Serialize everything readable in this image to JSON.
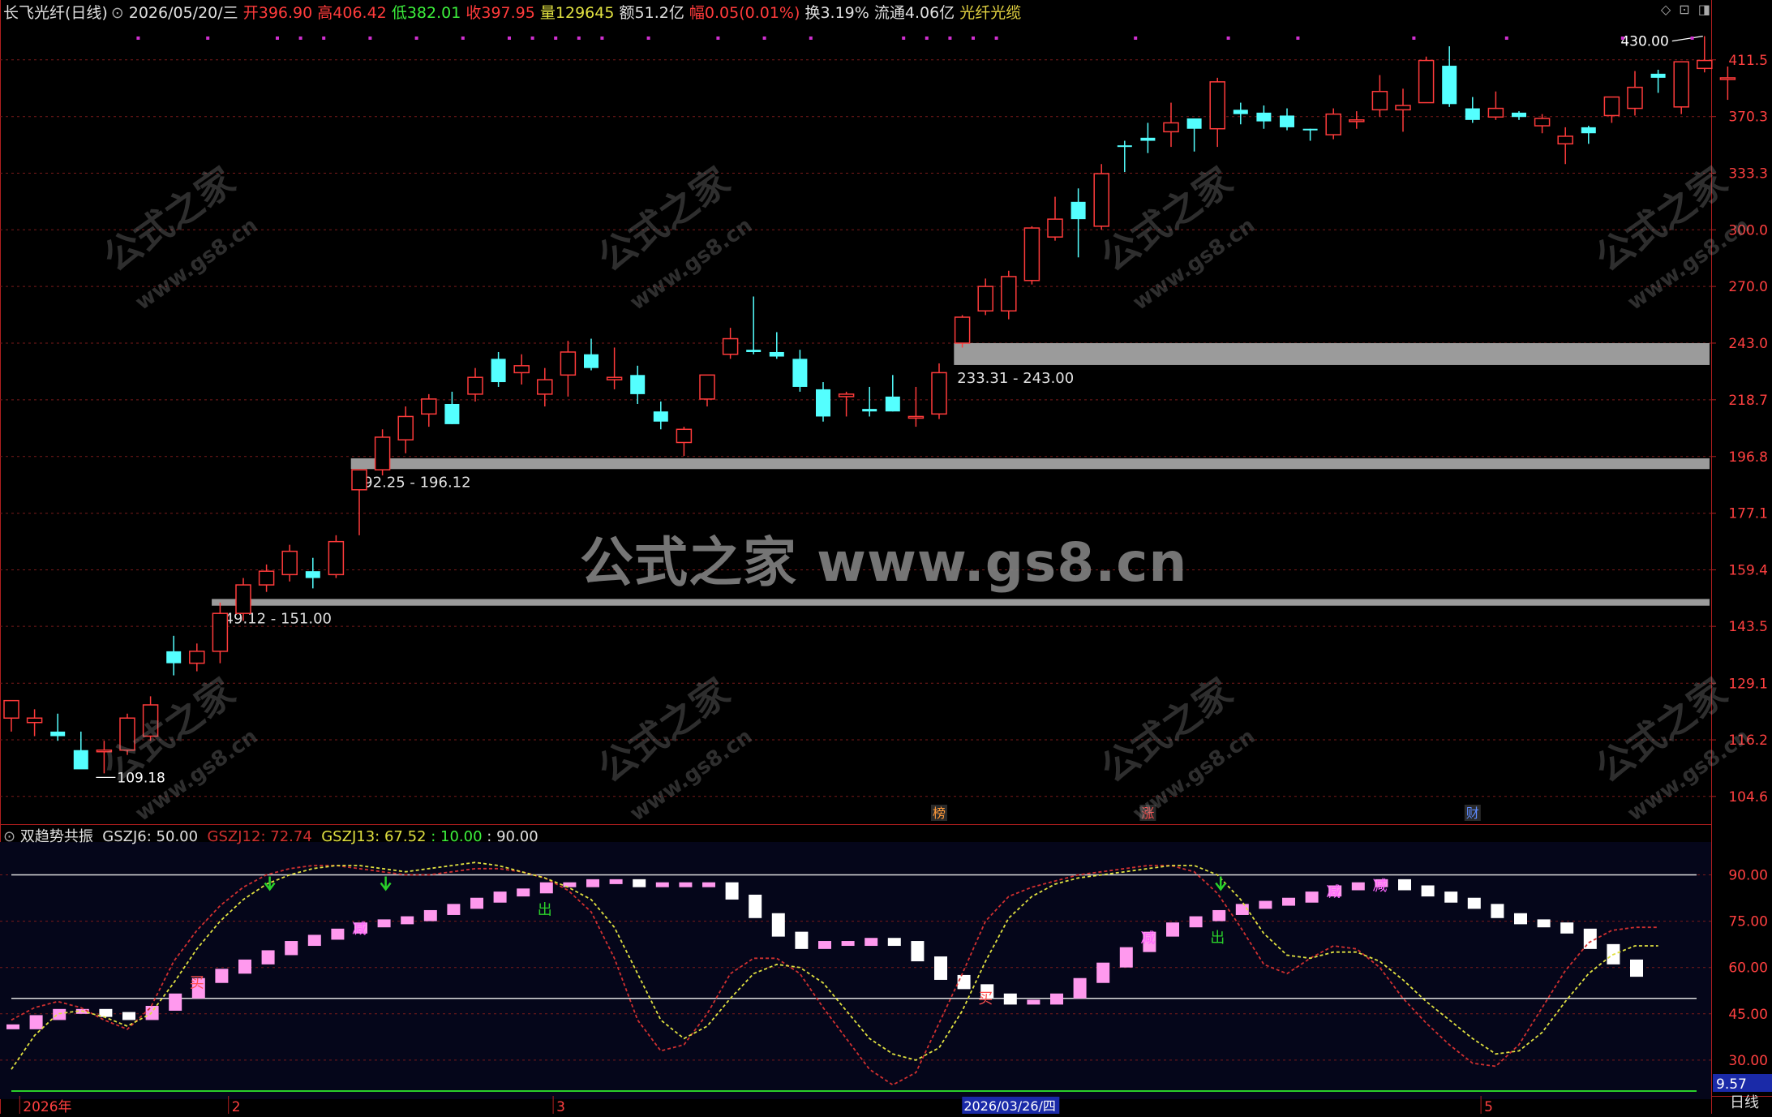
{
  "header": {
    "name": "长飞光纤(日线)",
    "date": "2026/05/20/三",
    "open_label": "开",
    "open": "396.90",
    "high_label": "高",
    "high": "406.42",
    "low_label": "低",
    "low": "382.01",
    "close_label": "收",
    "close": "397.95",
    "vol_label": "量",
    "vol": "129645",
    "amt_label": "额",
    "amt": "51.2亿",
    "chg_label": "幅",
    "chg": "0.05(0.01%)",
    "turn_label": "换",
    "turn": "3.19%",
    "float_label": "流通",
    "float": "4.06亿",
    "sector": "光纤光缆"
  },
  "indicator_header": {
    "name": "双趋势共振",
    "gszj6_label": "GSZJ6:",
    "gszj6": "50.00",
    "gszj12_label": "GSZJ12:",
    "gszj12": "72.74",
    "gszj13_label": "GSZJ13:",
    "gszj13": "67.52",
    "l10_label": ":",
    "l10": "10.00",
    "l90_label": ":",
    "l90": "90.00"
  },
  "watermark": {
    "big": "公式之家 www.gs8.cn",
    "small_cn": "公式之家",
    "small_url": "www.gs8.cn"
  },
  "x_axis": {
    "labels": [
      {
        "text": "2026年",
        "i": 0.5
      },
      {
        "text": "2",
        "i": 9.5
      },
      {
        "text": "3",
        "i": 23.5
      },
      {
        "text": "2026/03/26/四",
        "i": 41.2
      },
      {
        "text": "5",
        "i": 63.5
      }
    ]
  },
  "period_label": "日线",
  "colors": {
    "up": "#ff3b3b",
    "down": "#54ffff",
    "grid": "#7a1a1a",
    "axis": "#b01e1e",
    "line12": "#d03030",
    "line13": "#e0e040",
    "bar_pink": "#ff99ee",
    "bar_white": "#ffffff",
    "zone": "#9b9b9b",
    "bg": "#000000",
    "ind_bg": "#05061a"
  },
  "badges": [
    {
      "text": "榜",
      "i": 40,
      "color": "#ff9a3a"
    },
    {
      "text": "涨",
      "i": 49,
      "color": "#ff5050"
    },
    {
      "text": "财",
      "i": 63,
      "color": "#5d8bff"
    }
  ],
  "chart_data": [
    {
      "type": "candlestick",
      "title": "长飞光纤(日线)",
      "y_ticks": [
        411.5,
        370.3,
        333.3,
        300.0,
        270.0,
        243.0,
        218.7,
        196.8,
        177.1,
        159.4,
        143.5,
        129.1,
        116.2,
        104.6
      ],
      "ylim": [
        101,
        433
      ],
      "candles": [
        {
          "o": 121,
          "h": 125,
          "l": 118,
          "c": 125
        },
        {
          "o": 120,
          "h": 123,
          "l": 117,
          "c": 121
        },
        {
          "o": 118,
          "h": 122,
          "l": 116,
          "c": 117
        },
        {
          "o": 114,
          "h": 118,
          "l": 112,
          "c": 110
        },
        {
          "o": 114,
          "h": 116,
          "l": 109.18,
          "c": 114
        },
        {
          "o": 114,
          "h": 122,
          "l": 113,
          "c": 121
        },
        {
          "o": 117,
          "h": 126,
          "l": 116,
          "c": 124
        },
        {
          "o": 137,
          "h": 141,
          "l": 131,
          "c": 134
        },
        {
          "o": 134,
          "h": 139,
          "l": 132,
          "c": 137
        },
        {
          "o": 137,
          "h": 150,
          "l": 134,
          "c": 147
        },
        {
          "o": 147,
          "h": 157,
          "l": 145,
          "c": 155
        },
        {
          "o": 155,
          "h": 161,
          "l": 153,
          "c": 159
        },
        {
          "o": 158,
          "h": 167,
          "l": 156,
          "c": 165
        },
        {
          "o": 159,
          "h": 163,
          "l": 154,
          "c": 157
        },
        {
          "o": 158,
          "h": 170,
          "l": 157,
          "c": 168
        },
        {
          "o": 185,
          "h": 190,
          "l": 170,
          "c": 192
        },
        {
          "o": 192,
          "h": 207,
          "l": 190,
          "c": 204
        },
        {
          "o": 203,
          "h": 216,
          "l": 198,
          "c": 212
        },
        {
          "o": 213,
          "h": 221,
          "l": 208,
          "c": 219
        },
        {
          "o": 217,
          "h": 222,
          "l": 209,
          "c": 209
        },
        {
          "o": 221,
          "h": 232,
          "l": 218,
          "c": 228
        },
        {
          "o": 236,
          "h": 239,
          "l": 224,
          "c": 226
        },
        {
          "o": 230,
          "h": 238,
          "l": 225,
          "c": 233
        },
        {
          "o": 221,
          "h": 232,
          "l": 216,
          "c": 227
        },
        {
          "o": 229,
          "h": 244,
          "l": 220,
          "c": 239
        },
        {
          "o": 238,
          "h": 245,
          "l": 231,
          "c": 232
        },
        {
          "o": 227,
          "h": 241,
          "l": 223,
          "c": 228
        },
        {
          "o": 229,
          "h": 233,
          "l": 217,
          "c": 221
        },
        {
          "o": 214,
          "h": 218,
          "l": 207,
          "c": 210
        },
        {
          "o": 202,
          "h": 208,
          "l": 197,
          "c": 207
        },
        {
          "o": 219,
          "h": 229,
          "l": 216,
          "c": 229
        },
        {
          "o": 238,
          "h": 250,
          "l": 236,
          "c": 245
        },
        {
          "o": 240,
          "h": 265,
          "l": 238,
          "c": 239
        },
        {
          "o": 239,
          "h": 248,
          "l": 236,
          "c": 237
        },
        {
          "o": 236,
          "h": 240,
          "l": 222,
          "c": 224
        },
        {
          "o": 223,
          "h": 226,
          "l": 210,
          "c": 212
        },
        {
          "o": 220,
          "h": 222,
          "l": 212,
          "c": 221
        },
        {
          "o": 215,
          "h": 224,
          "l": 212,
          "c": 214
        },
        {
          "o": 220,
          "h": 229,
          "l": 214,
          "c": 214
        },
        {
          "o": 212,
          "h": 224,
          "l": 208,
          "c": 212
        },
        {
          "o": 213,
          "h": 234,
          "l": 211,
          "c": 230
        },
        {
          "o": 243,
          "h": 256,
          "l": 241,
          "c": 255
        },
        {
          "o": 258,
          "h": 274,
          "l": 256,
          "c": 270
        },
        {
          "o": 258,
          "h": 278,
          "l": 254,
          "c": 275
        },
        {
          "o": 273,
          "h": 302,
          "l": 271,
          "c": 301
        },
        {
          "o": 296,
          "h": 319,
          "l": 294,
          "c": 306
        },
        {
          "o": 316,
          "h": 324,
          "l": 285,
          "c": 306
        },
        {
          "o": 302,
          "h": 339,
          "l": 300,
          "c": 333
        },
        {
          "o": 351,
          "h": 354,
          "l": 334,
          "c": 350
        },
        {
          "o": 356,
          "h": 366,
          "l": 346,
          "c": 354
        },
        {
          "o": 360,
          "h": 380,
          "l": 350,
          "c": 366
        },
        {
          "o": 369,
          "h": 368,
          "l": 347,
          "c": 362
        },
        {
          "o": 362,
          "h": 398,
          "l": 350,
          "c": 395
        },
        {
          "o": 375,
          "h": 380,
          "l": 365,
          "c": 372
        },
        {
          "o": 373,
          "h": 378,
          "l": 362,
          "c": 367
        },
        {
          "o": 371,
          "h": 376,
          "l": 361,
          "c": 363
        },
        {
          "o": 362,
          "h": 362,
          "l": 354,
          "c": 361
        },
        {
          "o": 358,
          "h": 376,
          "l": 355,
          "c": 372
        },
        {
          "o": 368,
          "h": 374,
          "l": 362,
          "c": 368
        },
        {
          "o": 375,
          "h": 400,
          "l": 370,
          "c": 388
        },
        {
          "o": 375,
          "h": 390,
          "l": 360,
          "c": 378
        },
        {
          "o": 380,
          "h": 414,
          "l": 380,
          "c": 411
        },
        {
          "o": 407,
          "h": 422,
          "l": 377,
          "c": 379
        },
        {
          "o": 376,
          "h": 384,
          "l": 366,
          "c": 368
        },
        {
          "o": 370,
          "h": 388,
          "l": 368,
          "c": 376
        },
        {
          "o": 373,
          "h": 374,
          "l": 368,
          "c": 370
        },
        {
          "o": 364,
          "h": 372,
          "l": 359,
          "c": 369
        },
        {
          "o": 352,
          "h": 363,
          "l": 339,
          "c": 357
        },
        {
          "o": 363,
          "h": 364,
          "l": 352,
          "c": 359
        },
        {
          "o": 371,
          "h": 382,
          "l": 366,
          "c": 384
        },
        {
          "o": 376,
          "h": 403,
          "l": 371,
          "c": 391
        },
        {
          "o": 401,
          "h": 404,
          "l": 387,
          "c": 398
        },
        {
          "o": 377,
          "h": 409,
          "l": 372,
          "c": 410
        },
        {
          "o": 405,
          "h": 430,
          "l": 402,
          "c": 411
        },
        {
          "o": 396.9,
          "h": 406.42,
          "l": 382.01,
          "c": 397.95
        }
      ],
      "zones": [
        {
          "label": "233.31 - 243.00",
          "low": 233.31,
          "high": 243.0,
          "start": 41
        },
        {
          "label": "192.25 - 196.12",
          "low": 192.25,
          "high": 196.12,
          "start": 15
        },
        {
          "label": "149.12 - 151.00",
          "low": 149.12,
          "high": 151.0,
          "start": 9
        }
      ],
      "annotations": [
        {
          "text": "430.00",
          "i": 73,
          "value": 430.0
        },
        {
          "text": "109.18",
          "i": 4,
          "value": 109.18
        }
      ]
    },
    {
      "type": "line",
      "title": "双趋势共振",
      "y_ticks": [
        90.0,
        75.0,
        60.0,
        45.0,
        30.0
      ],
      "ylim": [
        20,
        98
      ],
      "hlines": [
        90,
        50
      ],
      "last_value_label": "9.57",
      "series": [
        {
          "name": "GSZJ12",
          "values": [
            43,
            47,
            49,
            47,
            43,
            40,
            47,
            62,
            72,
            80,
            86,
            90,
            92,
            93,
            93,
            92,
            91,
            90,
            90,
            91,
            92,
            92,
            91,
            89,
            85,
            78,
            63,
            43,
            33,
            35,
            45,
            58,
            63,
            63,
            58,
            47,
            37,
            27,
            22,
            26,
            42,
            58,
            75,
            83,
            86,
            88,
            90,
            91,
            92,
            93,
            93,
            91,
            84,
            73,
            61,
            58,
            63,
            67,
            66,
            60,
            50,
            42,
            35,
            29,
            28,
            35,
            47,
            59,
            68,
            72,
            73,
            73
          ]
        },
        {
          "name": "GSZJ13",
          "values": [
            27,
            38,
            45,
            46,
            44,
            41,
            45,
            55,
            66,
            75,
            82,
            87,
            90,
            92,
            93,
            93,
            92,
            91,
            92,
            93,
            94,
            93,
            91,
            89,
            86,
            82,
            73,
            58,
            43,
            37,
            41,
            50,
            58,
            61,
            60,
            55,
            46,
            37,
            32,
            30,
            34,
            46,
            62,
            76,
            83,
            87,
            89,
            90,
            91,
            92,
            93,
            93,
            90,
            82,
            71,
            64,
            63,
            65,
            65,
            62,
            56,
            49,
            43,
            37,
            32,
            33,
            39,
            49,
            58,
            64,
            67,
            67
          ]
        },
        {
          "name": "GSZJ6",
          "values": [
            40,
            43,
            45,
            45,
            44,
            43,
            46,
            50,
            55,
            58,
            61,
            64,
            67,
            69,
            71,
            73,
            74,
            75,
            77,
            79,
            81,
            83,
            84,
            86,
            86,
            87,
            87,
            86,
            86,
            86,
            86,
            82,
            76,
            70,
            66,
            67,
            67,
            68,
            67,
            62,
            56,
            53,
            50,
            48,
            48,
            50,
            55,
            60,
            65,
            70,
            73,
            75,
            77,
            79,
            80,
            81,
            83,
            85,
            86,
            87,
            85,
            83,
            81,
            79,
            76,
            74,
            73,
            71,
            66,
            61,
            57,
            54,
            51,
            50,
            51,
            53,
            55,
            58
          ]
        }
      ],
      "bar_colors": "pink rising / white falling",
      "signals": [
        {
          "text": "出",
          "i": 23
        },
        {
          "text": "出",
          "i": 52
        },
        {
          "text": "减",
          "i": 15
        },
        {
          "text": "减",
          "i": 49
        },
        {
          "text": "减",
          "i": 57
        },
        {
          "text": "减",
          "i": 59
        },
        {
          "text": "买",
          "i": 8
        },
        {
          "text": "买",
          "i": 42
        }
      ]
    }
  ]
}
